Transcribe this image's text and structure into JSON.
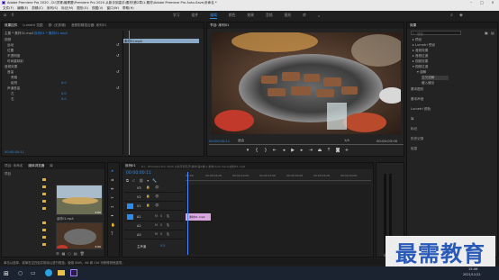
{
  "titlebar": {
    "title": "Adobe Premiere Pro 2020 - D:\\学清\\最需要\\Premiere Pro 2020 从新手到高手\\素材\\第2章\\1.素材\\Adobe Premiere Pro Auto-Save\\未命名 *"
  },
  "menubar": {
    "items": [
      "文件(F)",
      "编辑(E)",
      "剪辑(C)",
      "序列(S)",
      "标记(M)",
      "图形(G)",
      "视图(V)",
      "窗口(W)",
      "帮助(H)"
    ]
  },
  "workspaces": {
    "items": [
      "学习",
      "组件",
      "编辑",
      "颜色",
      "效果",
      "音频",
      "图形",
      "库"
    ],
    "active": "编辑"
  },
  "effect_controls": {
    "tabs": [
      "效果控件",
      "Lumetri 范围",
      "源: (无剪辑)",
      "音频剪辑混合器: 序列01"
    ],
    "source_label": "主要 * 素材01.mp4",
    "sequence_label": "序列01 * 素材01.mp4",
    "clip_label": "素材01.mp4",
    "section_video": "视频",
    "rows": [
      "运动",
      "位置",
      "不透明度",
      "时间重映射",
      "音频效果",
      "音量",
      "旁路",
      "级别",
      "声道音量",
      "左",
      "右"
    ],
    "values": [
      "0.0",
      "0.0",
      "0.0"
    ],
    "timecode": "00:00:00:11"
  },
  "program_monitor": {
    "tabs": [
      "节目: 序列01"
    ],
    "timecode_left": "00:00:00:11",
    "fit": "适合",
    "ratio": "1/4",
    "timecode_right": "00:00:03:00"
  },
  "right_panel": {
    "tab": "效果",
    "search_placeholder": "搜索",
    "tree": [
      "预设",
      "Lumetri 预设",
      "音频效果",
      "音频过渡",
      "视频效果",
      "视频过渡",
      "溶解",
      "交叉溶解",
      "缓入缓出"
    ],
    "sections": [
      "基本图形",
      "基本声音",
      "Lumetri 颜色",
      "库",
      "标记",
      "历史记录",
      "信息"
    ]
  },
  "project": {
    "tabs": [
      "项目: 未命名",
      "媒体浏览器",
      "库"
    ],
    "path": "项目",
    "thumbs": [
      {
        "label": "素材01.mp4",
        "duration": "3:00"
      },
      {
        "label": "序列01",
        "duration": "3:00"
      }
    ]
  },
  "timeline": {
    "tab": "序列01",
    "timecode": "00:00:00:11",
    "ruler": [
      "00:00",
      "00:00:05:00",
      "00:00:10:00",
      "00:00:15:00",
      "00:00:20:00",
      "00:00:25:00",
      "00:00:30:00"
    ],
    "tracks_video": [
      "V3",
      "V2",
      "V1"
    ],
    "tracks_audio": [
      "A1",
      "A2",
      "A3"
    ],
    "master": "主声道",
    "master_value": "0.0",
    "clip_label": "素材01.mp4",
    "path_hint": "D:\\...\\Premiere Pro 2020 从新手到高手\\素材\\第2章\\1.素材\\Auto-Save\\素材01.mp4"
  },
  "status": {
    "text": "单击以选择，或单击空白处并拖动以进行框选。使用 Shift、Alt 和 Ctrl 可获得其他选项。"
  },
  "taskbar": {
    "time": "15:46",
    "date": "2021/11/12"
  },
  "watermark": {
    "text": "最需教育"
  },
  "colors": {
    "accent": "#2d8ceb",
    "clip": "#d9a6e0",
    "playhead": "#4a8cff"
  }
}
